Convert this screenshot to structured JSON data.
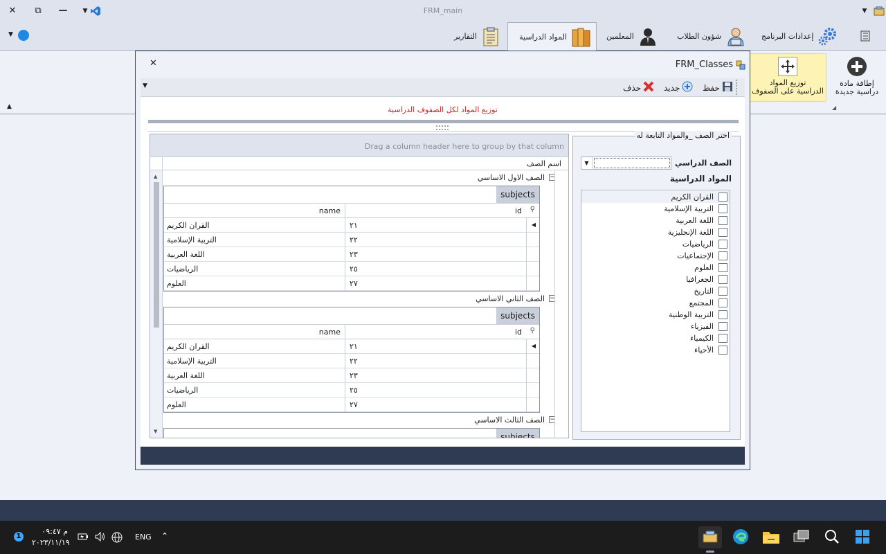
{
  "window": {
    "title": "FRM_main",
    "controls": {
      "close": "✕",
      "restore": "⧉",
      "minimize": "—"
    }
  },
  "ribbon": {
    "tabs": [
      {
        "label": "إعدادات البرنامج",
        "icon": "gears-icon"
      },
      {
        "label": "شؤون الطلاب",
        "icon": "students-icon"
      },
      {
        "label": "المعلمين",
        "icon": "teacher-icon"
      },
      {
        "label": "المواد الدراسية",
        "icon": "books-icon",
        "active": true
      },
      {
        "label": "التقارير",
        "icon": "clipboard-icon"
      }
    ],
    "buttons": [
      {
        "line1": "إطافة مادة",
        "line2": "دراسية جديدة",
        "icon": "add-circle-icon"
      },
      {
        "line1": "توزيع المواد",
        "line2": "الدراسية على الصفوف",
        "icon": "distribute-icon",
        "selected": true
      }
    ]
  },
  "child_window": {
    "title": "FRM_Classes",
    "close": "✕",
    "toolbar": {
      "save": "حفظ",
      "new": "جديد",
      "delete": "حذف"
    },
    "heading": "توزيع المواد لكل الصفوف الدراسية",
    "grid": {
      "group_panel_hint": "Drag a column header here to group by that column",
      "column_header": "اسم الصف",
      "detail_tab": "subjects",
      "detail_columns": {
        "id": "id",
        "name": "name"
      },
      "groups": [
        {
          "label": "الصف الاول الاساسي",
          "rows": [
            {
              "id": "٢١",
              "name": "القران الكريم"
            },
            {
              "id": "٢٢",
              "name": "التربية الإسلامية"
            },
            {
              "id": "٢٣",
              "name": "اللغة العربية"
            },
            {
              "id": "٢٥",
              "name": "الرياضيات"
            },
            {
              "id": "٢٧",
              "name": "العلوم"
            }
          ]
        },
        {
          "label": "الصف الثاني الاساسي",
          "rows": [
            {
              "id": "٢١",
              "name": "القران الكريم"
            },
            {
              "id": "٢٢",
              "name": "التربية الإسلامية"
            },
            {
              "id": "٢٣",
              "name": "اللغة العربية"
            },
            {
              "id": "٢٥",
              "name": "الرياضيات"
            },
            {
              "id": "٢٧",
              "name": "العلوم"
            }
          ]
        },
        {
          "label": "الصف الثالث الاساسي"
        }
      ]
    },
    "right_panel": {
      "legend": "اختر الصف _والمواد التابعة له",
      "class_label": "الصف الدراسي :",
      "class_value": "",
      "subjects_label": "المواد الدراسية",
      "subjects": [
        "القران الكريم",
        "التربية الإسلامية",
        "اللغة العربية",
        "اللغة الإنجليزية",
        "الرياضيات",
        "الإجتماعيات",
        "العلوم",
        "الجغرافيا",
        "التاريخ",
        "المجتمع",
        "التربية الوطنية",
        "الفيزياء",
        "الكيمياء",
        "الأحياء"
      ]
    }
  },
  "taskbar": {
    "time": "٠٩:٤٧",
    "ampm": "م",
    "date": "٢٠٢٣/١١/١٩",
    "language": "ENG"
  },
  "colors": {
    "accent": "#2e3b52",
    "heading_red": "#e02020",
    "selected_ribbon": "#fcf3b5"
  }
}
